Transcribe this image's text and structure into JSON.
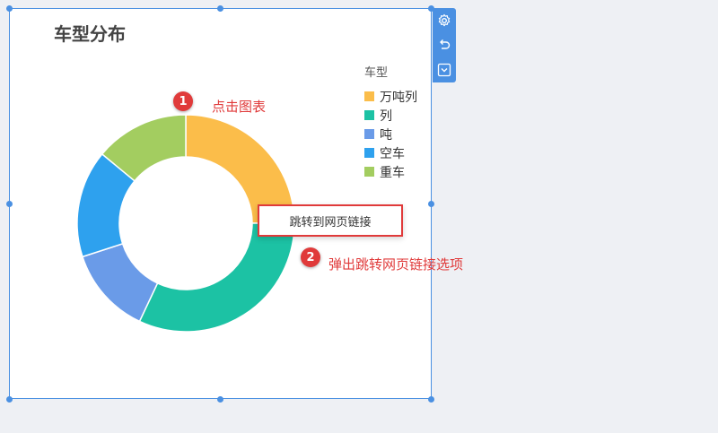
{
  "widget": {
    "title": "车型分布",
    "border_color": "#4a90e2"
  },
  "toolbar": {
    "icons": [
      "gear-icon",
      "undo-icon",
      "chevron-down-icon"
    ]
  },
  "chart_data": {
    "type": "pie",
    "legend_title": "车型",
    "legend_position": "top-right",
    "series": [
      {
        "name": "万吨列",
        "value": 25,
        "color": "#fbbd4a"
      },
      {
        "name": "列",
        "value": 32,
        "color": "#1cc2a4"
      },
      {
        "name": "吨",
        "value": 13,
        "color": "#6a9be8"
      },
      {
        "name": "空车",
        "value": 16,
        "color": "#2ea1ee"
      },
      {
        "name": "重车",
        "value": 14,
        "color": "#a3cd60"
      }
    ]
  },
  "annotations": {
    "step1_number": "1",
    "step1_text": "点击图表",
    "step2_number": "2",
    "step2_text": "弹出跳转网页链接选项",
    "color": "#e03a3a"
  },
  "popup": {
    "label": "跳转到网页链接"
  }
}
